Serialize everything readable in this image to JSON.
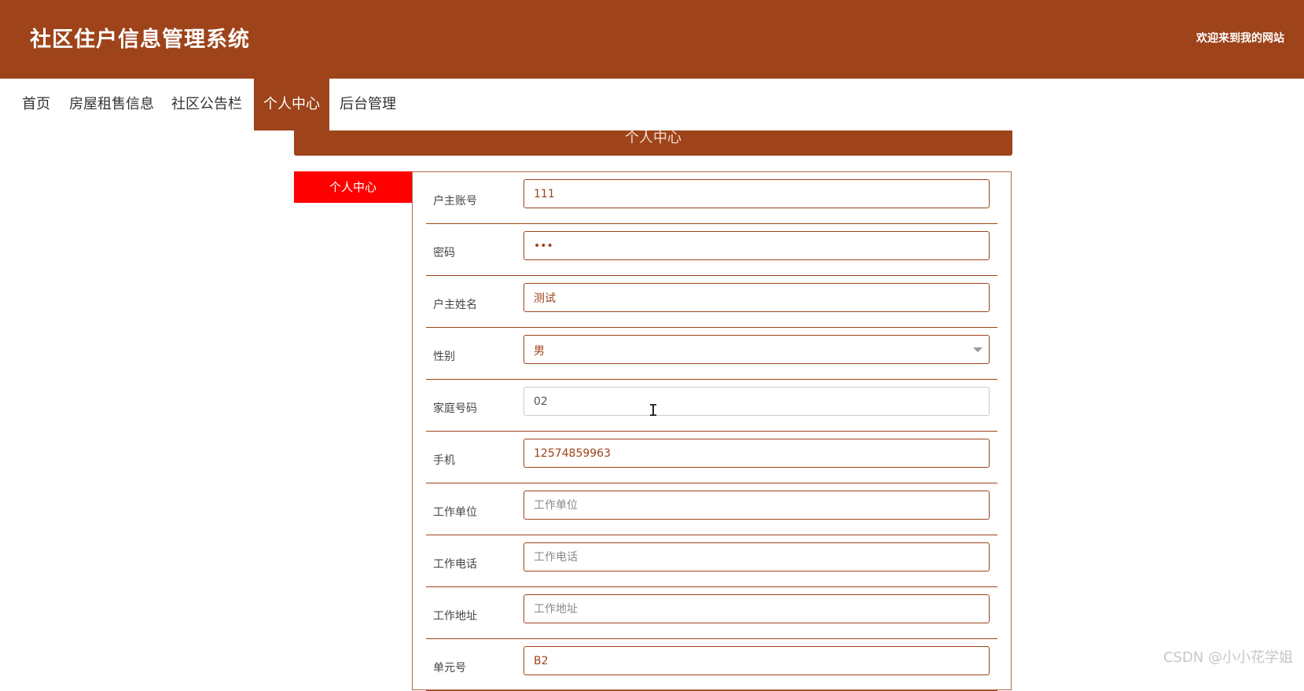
{
  "header": {
    "title": "社区住户信息管理系统",
    "welcome": "欢迎来到我的网站",
    "color": "#9e431a"
  },
  "nav": {
    "items": [
      {
        "label": "首页"
      },
      {
        "label": "房屋租售信息"
      },
      {
        "label": "社区公告栏"
      },
      {
        "label": "个人中心",
        "active": true
      },
      {
        "label": "后台管理"
      }
    ]
  },
  "section": {
    "title": "个人中心"
  },
  "sidebar": {
    "tab_label": "个人中心",
    "tab_color": "#ff0000"
  },
  "form": {
    "account": {
      "label": "户主账号",
      "value": "111"
    },
    "password": {
      "label": "密码",
      "value": "•••"
    },
    "owner_name": {
      "label": "户主姓名",
      "value": "测试"
    },
    "gender": {
      "label": "性别",
      "value": "男"
    },
    "family_number": {
      "label": "家庭号码",
      "value": "02"
    },
    "mobile": {
      "label": "手机",
      "value": "12574859963"
    },
    "work_unit": {
      "label": "工作单位",
      "value": "",
      "placeholder": "工作单位"
    },
    "work_phone": {
      "label": "工作电话",
      "value": "",
      "placeholder": "工作电话"
    },
    "work_address": {
      "label": "工作地址",
      "value": "",
      "placeholder": "工作地址"
    },
    "unit_number": {
      "label": "单元号",
      "value": "B2"
    }
  },
  "watermark": "CSDN @小小花学姐"
}
